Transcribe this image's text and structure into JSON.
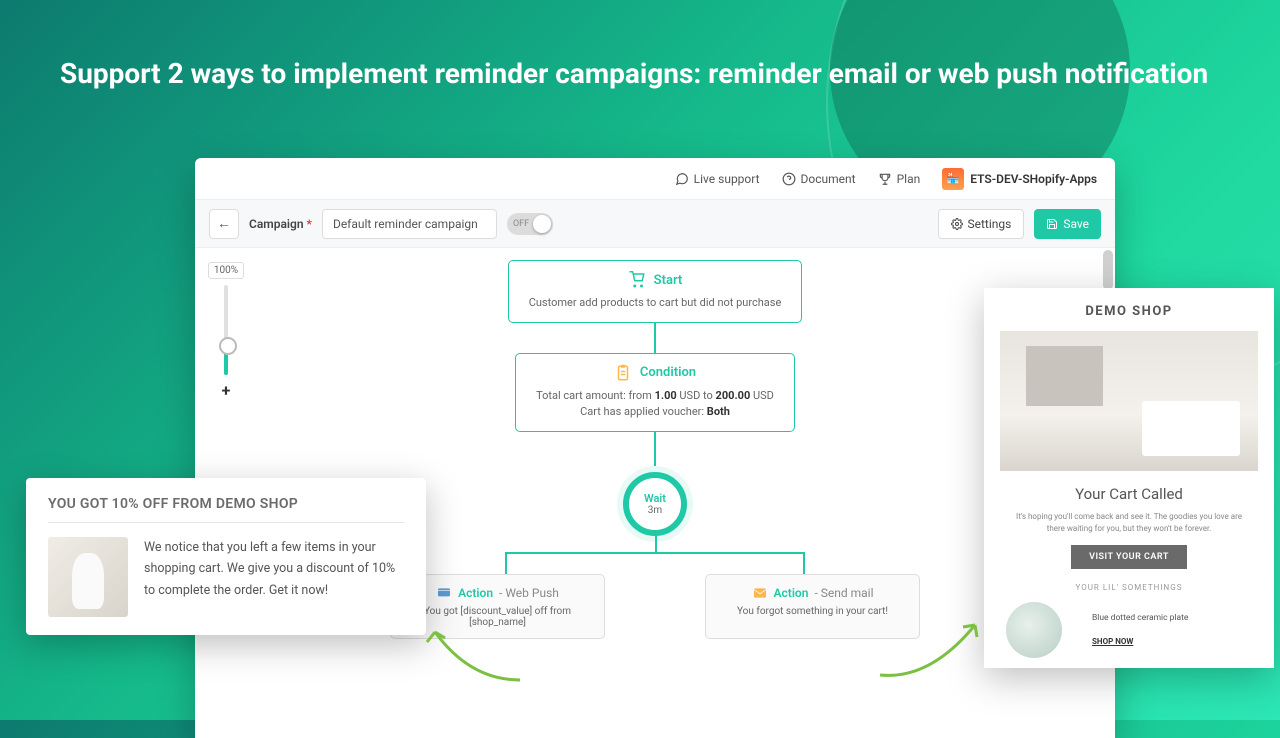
{
  "headline": "Support 2 ways to implement reminder campaigns: reminder email or web push notification",
  "topbar": {
    "live_support": "Live support",
    "document": "Document",
    "plan": "Plan",
    "user_name": "ETS-DEV-SHopify-Apps"
  },
  "toolbar": {
    "campaign_label": "Campaign",
    "campaign_value": "Default reminder campaign",
    "toggle_state": "OFF",
    "settings_label": "Settings",
    "save_label": "Save"
  },
  "zoom": {
    "level": "100%"
  },
  "flow": {
    "start": {
      "title": "Start",
      "subtitle": "Customer add products to cart but did not purchase"
    },
    "condition": {
      "title": "Condition",
      "line1_pre": "Total cart amount: from ",
      "line1_v1": "1.00",
      "line1_mid": " USD to ",
      "line1_v2": "200.00",
      "line1_post": " USD",
      "line2_pre": "Cart has applied voucher: ",
      "line2_val": "Both"
    },
    "wait": {
      "label": "Wait",
      "time": "3m"
    },
    "action_push": {
      "label": "Action",
      "type": "Web Push",
      "body": "You got [discount_value] off from [shop_name]"
    },
    "action_mail": {
      "label": "Action",
      "type": "Send mail",
      "body": "You forgot something in your cart!"
    }
  },
  "push_preview": {
    "title": "YOU GOT 10% OFF FROM DEMO SHOP",
    "body": "We notice that you left a few items in your shopping cart. We give you a discount of 10% to complete the order. Get it now!"
  },
  "email_preview": {
    "shop": "DEMO SHOP",
    "heading": "Your Cart Called",
    "paragraph": "It's hoping you'll come back and see it. The goodies you love are there waiting for you, but they won't be forever.",
    "cta": "VISIT YOUR CART",
    "sub": "YOUR LIL' SOMETHINGS",
    "product_name": "Blue dotted ceramic plate",
    "product_link": "SHOP NOW"
  }
}
